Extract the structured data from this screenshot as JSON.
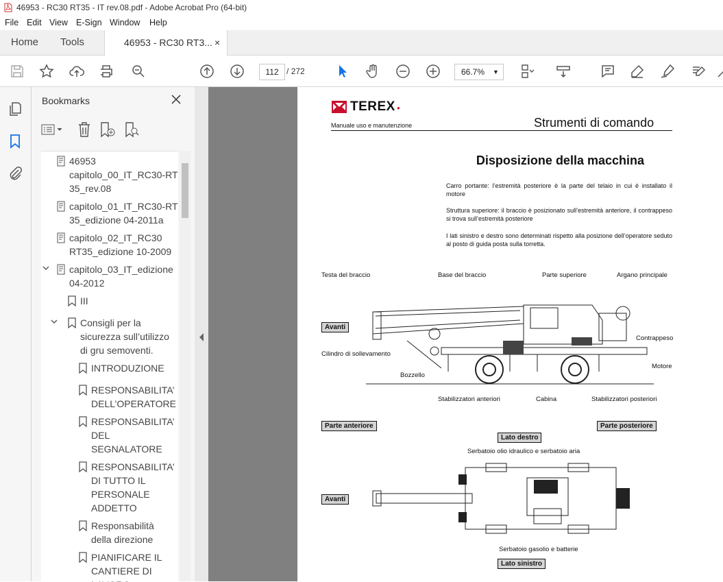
{
  "window": {
    "title": "46953 - RC30 RT35 - IT rev.08.pdf - Adobe Acrobat Pro (64-bit)"
  },
  "menu": {
    "items": [
      "File",
      "Edit",
      "View",
      "E-Sign",
      "Window",
      "Help"
    ]
  },
  "tabs": {
    "home": "Home",
    "tools": "Tools",
    "doc": "46953 - RC30 RT3...",
    "close": "×"
  },
  "toolbar": {
    "page_current": "112",
    "page_sep": "/",
    "page_total": "272",
    "zoom": "66.7%"
  },
  "panel": {
    "title": "Bookmarks",
    "items": [
      {
        "label": "46953\ncapitolo_00_IT_RC30-RT\n35_rev.08"
      },
      {
        "label": "capitolo_01_IT_RC30-RT\n35_edizione 04-2011a"
      },
      {
        "label": "capitolo_02_IT_RC30\nRT35_edizione 10-2009"
      },
      {
        "label": "capitolo_03_IT_edizione\n04-2012"
      },
      {
        "label": "III"
      },
      {
        "label": "Consigli per la\nsicurezza sull’utilizzo\ndi gru semoventi."
      },
      {
        "label": "INTRODUZIONE"
      },
      {
        "label": "RESPONSABILITA’\nDELL’OPERATORE"
      },
      {
        "label": "RESPONSABILITA’\nDEL\nSEGNALATORE"
      },
      {
        "label": "RESPONSABILITA’\nDI TUTTO IL\nPERSONALE\nADDETTO"
      },
      {
        "label": "Responsabilità\ndella direzione"
      },
      {
        "label": "PIANIFICARE IL\nCANTIERE DI\nLAVORO"
      }
    ]
  },
  "pdf": {
    "brand": "TEREX",
    "manual": "Manuale uso e manutenzione",
    "section": "Strumenti di comando",
    "heading": "Disposizione della macchina",
    "p1": "Carro portante: l’estremità posteriore è la parte del telaio in cui è installato il motore",
    "p2": "Struttura superiore: il braccio è posizionato sull’estremità anteriore, il contrappeso si trova sull’estremità posteriore",
    "p3": "I lati sinistro e destro sono determinati rispetto alla posizione dell’operatore seduto al posto di guida posta sulla torretta.",
    "labels": {
      "testa": "Testa del braccio",
      "base": "Base del braccio",
      "superiore": "Parte superiore",
      "argano": "Argano principale",
      "contrappeso": "Contrappeso",
      "cilindro": "Cilindro di sollevamento",
      "motore": "Motore",
      "bozzello": "Bozzello",
      "stab_ant": "Stabilizzatori anteriori",
      "cabina": "Cabina",
      "stab_post": "Stabilizzatori posteriori",
      "serbatoio_olio": "Serbatoio olio idraulico e serbatoio aria",
      "serbatoio_gas": "Serbatoio gasolio e batterie"
    },
    "tags": {
      "avanti1": "Avanti",
      "parte_ant": "Parte anteriore",
      "parte_post": "Parte posteriore",
      "lato_destro": "Lato destro",
      "avanti2": "Avanti",
      "lato_sinistro": "Lato sinistro"
    }
  }
}
